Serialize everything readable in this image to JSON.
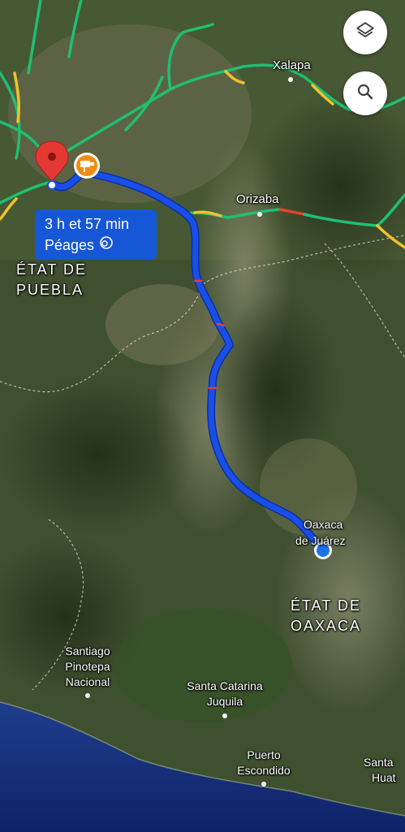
{
  "map": {
    "type": "satellite",
    "route_color": "#1a4fe6",
    "route_outline_color": "#0b2fa8"
  },
  "route_info": {
    "duration": "3 h et 57 min",
    "tolls_label": "Péages",
    "toll_icon": "toll-icon"
  },
  "labels": {
    "xalapa": "Xalapa",
    "orizaba": "Orizaba",
    "state_puebla_line1": "ÉTAT DE",
    "state_puebla_line2": "PUEBLA",
    "oaxaca_city_line1": "Oaxaca",
    "oaxaca_city_line2": "de Juárez",
    "state_oaxaca_line1": "ÉTAT DE",
    "state_oaxaca_line2": "OAXACA",
    "santiago_line1": "Santiago",
    "santiago_line2": "Pinotepa",
    "santiago_line3": "Nacional",
    "santa_catarina_line1": "Santa Catarina",
    "santa_catarina_line2": "Juquila",
    "puerto_line1": "Puerto",
    "puerto_line2": "Escondido",
    "santa_huat_line1": "Santa",
    "santa_huat_line2": "Huat"
  },
  "controls": {
    "layers_icon": "layers-icon",
    "search_icon": "search-icon"
  },
  "colors": {
    "traffic_green": "#1fbf73",
    "traffic_yellow": "#f2c12e",
    "traffic_red": "#e0442c",
    "destination_pin": "#e53935",
    "current_location": "#1a73e8",
    "camera_badge": "#f28c0f"
  }
}
